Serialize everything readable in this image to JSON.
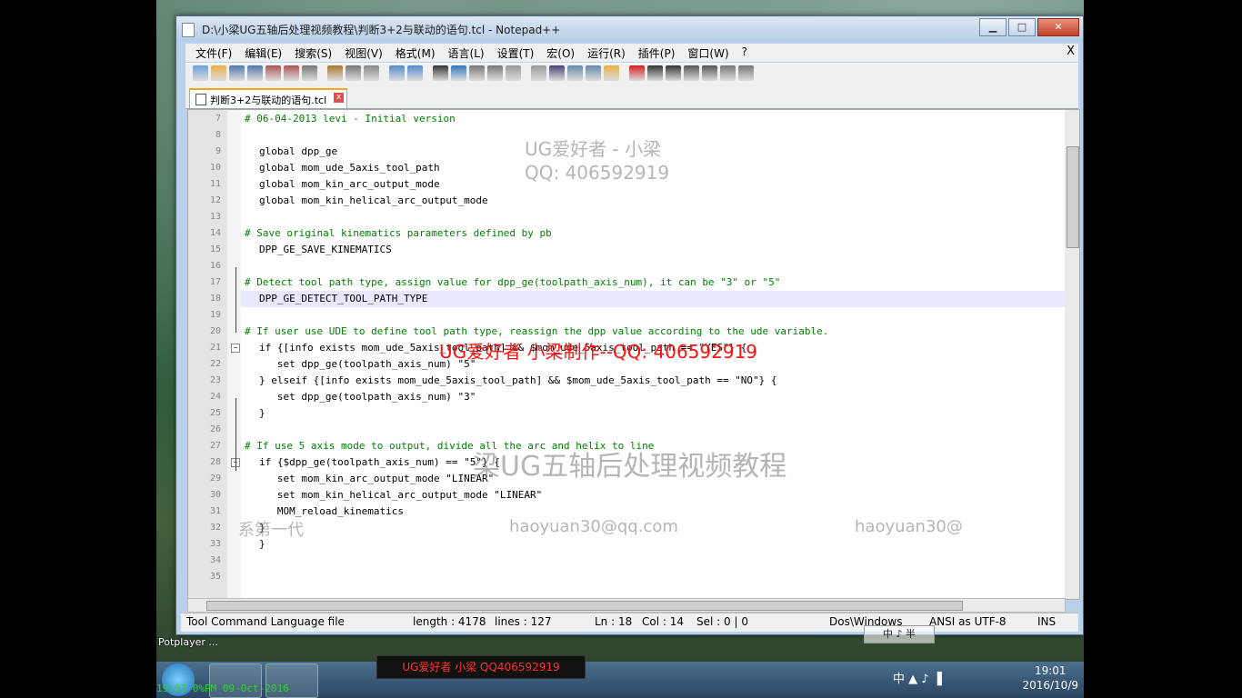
{
  "window": {
    "title": "D:\\小梁UG五轴后处理视频教程\\判断3+2与联动的语句.tcl - Notepad++",
    "buttons": {
      "minimize": "▁",
      "maximize": "□",
      "close": "✕"
    }
  },
  "menu": [
    "文件(F)",
    "编辑(E)",
    "搜索(S)",
    "视图(V)",
    "格式(M)",
    "语言(L)",
    "设置(T)",
    "宏(O)",
    "运行(R)",
    "插件(P)",
    "窗口(W)",
    "?"
  ],
  "menu_close": "X",
  "tab": {
    "label": "判断3+2与联动的语句.tcl",
    "close": "x"
  },
  "code_lines": [
    {
      "n": "7",
      "t": "# 06-04-2013 levi - Initial version"
    },
    {
      "n": "8",
      "t": ""
    },
    {
      "n": "9",
      "t": "global dpp_ge"
    },
    {
      "n": "10",
      "t": "global mom_ude_5axis_tool_path"
    },
    {
      "n": "11",
      "t": "global mom_kin_arc_output_mode"
    },
    {
      "n": "12",
      "t": "global mom_kin_helical_arc_output_mode"
    },
    {
      "n": "13",
      "t": ""
    },
    {
      "n": "14",
      "t": "# Save original kinematics parameters defined by pb"
    },
    {
      "n": "15",
      "t": "DPP_GE_SAVE_KINEMATICS"
    },
    {
      "n": "16",
      "t": ""
    },
    {
      "n": "17",
      "t": "# Detect tool path type, assign value for dpp_ge(toolpath_axis_num), it can be \"3\" or \"5\""
    },
    {
      "n": "18",
      "t": "DPP_GE_DETECT_TOOL_PATH_TYPE"
    },
    {
      "n": "19",
      "t": ""
    },
    {
      "n": "20",
      "t": "# If user use UDE to define tool path type, reassign the dpp value according to the ude variable."
    },
    {
      "n": "21",
      "t": "if {[info exists mom_ude_5axis_tool_path] && $mom_ude_5axis_tool_path == \"YES\"} {"
    },
    {
      "n": "22",
      "t": "   set dpp_ge(toolpath_axis_num) \"5\""
    },
    {
      "n": "23",
      "t": "} elseif {[info exists mom_ude_5axis_tool_path] && $mom_ude_5axis_tool_path == \"NO\"} {"
    },
    {
      "n": "24",
      "t": "   set dpp_ge(toolpath_axis_num) \"3\""
    },
    {
      "n": "25",
      "t": "}"
    },
    {
      "n": "26",
      "t": ""
    },
    {
      "n": "27",
      "t": "# If use 5 axis mode to output, divide all the arc and helix to line"
    },
    {
      "n": "28",
      "t": "if {$dpp_ge(toolpath_axis_num) == \"5\"} {"
    },
    {
      "n": "29",
      "t": "   set mom_kin_arc_output_mode \"LINEAR\""
    },
    {
      "n": "30",
      "t": "   set mom_kin_helical_arc_output_mode \"LINEAR\""
    },
    {
      "n": "31",
      "t": "   MOM_reload_kinematics"
    },
    {
      "n": "32",
      "t": "}"
    },
    {
      "n": "33",
      "t": "}"
    },
    {
      "n": "34",
      "t": ""
    },
    {
      "n": "35",
      "t": ""
    }
  ],
  "status": {
    "language": "Tool Command Language file",
    "length": "length : 4178",
    "lines": "lines : 127",
    "ln": "Ln : 18",
    "col": "Col : 14",
    "sel": "Sel : 0 | 0",
    "eol": "Dos\\Windows",
    "encoding": "ANSI as UTF-8",
    "ins": "INS"
  },
  "watermarks": {
    "top_name": "UG爱好者 - 小梁",
    "top_qq": "QQ: 406592919",
    "red": "UG爱好者  小梁制作--QQ: 406592919",
    "course": "梁UG五轴后处理视频教程",
    "email": "haoyuan30@qq.com",
    "email2": "haoyuan30@",
    "series": "系第一代"
  },
  "desktop": {
    "potplayer_label": "Potplayer ...",
    "ime_label": "中 ♪ 半",
    "osd_text": "UG爱好者  小梁  QQ406592919",
    "osd_time": "19:01 0%PM 09-Oct-2016"
  },
  "taskbar": {
    "time": "19:01",
    "date": "2016/10/9",
    "tray": "中 ▲ ♪ ▐"
  }
}
